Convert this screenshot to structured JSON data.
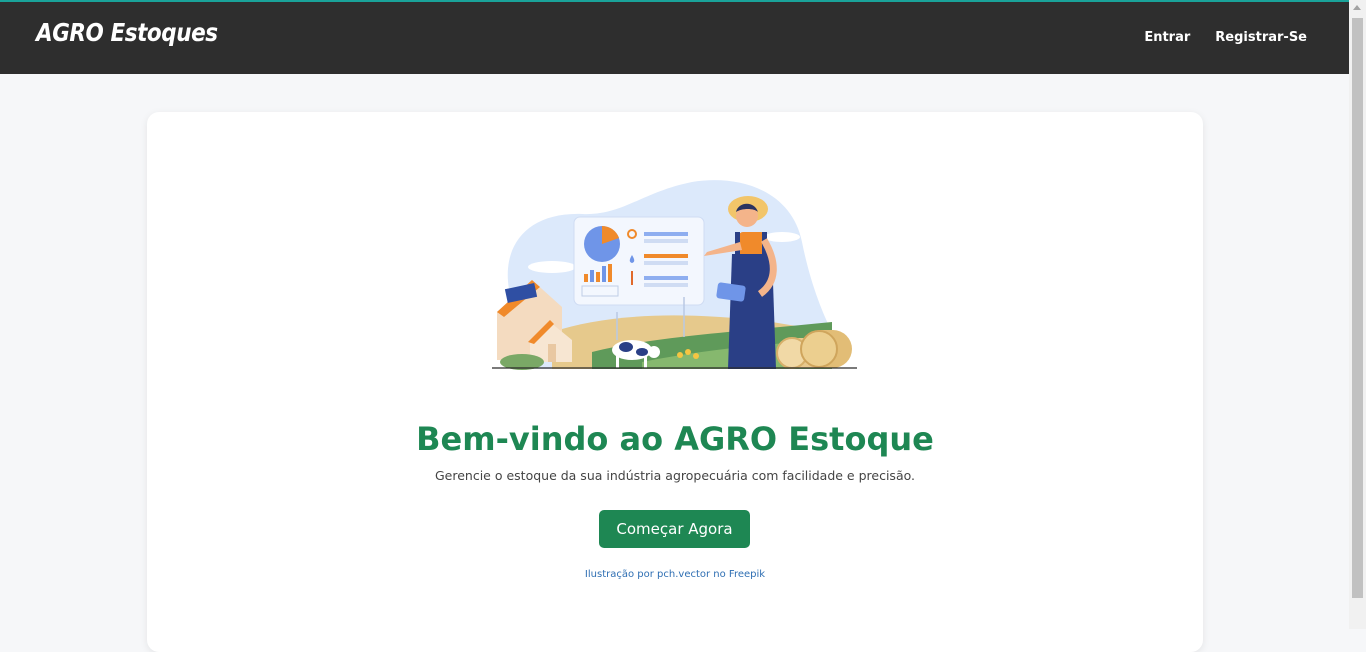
{
  "navbar": {
    "brand": "AGRO Estoques",
    "links": {
      "login": "Entrar",
      "register": "Registrar-Se"
    }
  },
  "hero": {
    "title": "Bem-vindo ao AGRO Estoque",
    "subtitle": "Gerencie o estoque da sua indústria agropecuária com facilidade e precisão.",
    "cta_label": "Começar Agora",
    "credit": "Ilustração por pch.vector no Freepik"
  },
  "colors": {
    "navbar_bg": "#2e2e2e",
    "accent_green": "#1e8753",
    "link_blue": "#2f6fb3",
    "page_bg": "#f6f7f9"
  },
  "icons": [
    "farmer-illustration",
    "pie-chart-icon",
    "sun-icon",
    "solar-panel-icon",
    "cow-icon",
    "hay-bale-icon"
  ]
}
